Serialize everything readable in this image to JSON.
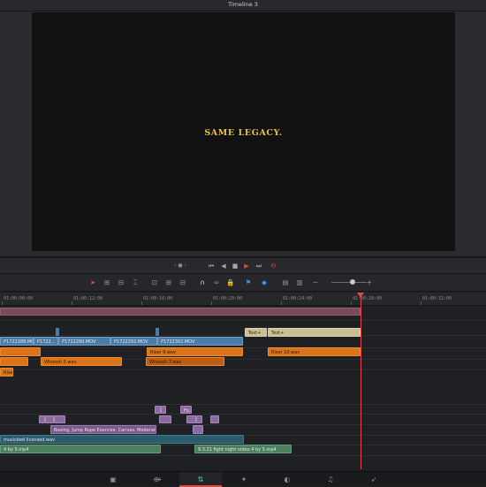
{
  "window": {
    "title": "Timeline 3"
  },
  "viewer": {
    "overlay_text": "SAME LEGACY."
  },
  "transport": {
    "jog_icon": "jog-wheel-icon",
    "buttons": [
      "first-frame-icon",
      "reverse-play-icon",
      "stop-icon",
      "play-icon",
      "last-frame-icon",
      "loop-icon"
    ],
    "accent": "#e04848"
  },
  "ruler": {
    "timecodes": [
      "01:00:08:00",
      "01:00:12:00",
      "01:00:16:00",
      "01:00:20:00",
      "01:00:24:00",
      "01:00:28:00",
      "01:00:32:00"
    ]
  },
  "clips": {
    "v2_title1": "Text+",
    "v2_title2": "Text+",
    "v1_a": "P1722288.MOV",
    "v1_b": "P1722...",
    "v1_c": "P1722290.MOV",
    "v1_d": "P1722292.MOV",
    "v1_e": "P1722302.MOV",
    "sfx_a": "Whoosh 5.wav",
    "sfx_b": "Riser 9.wav",
    "sfx_c": "Whoosh 7.wav",
    "sfx_d": "Riser 10.wav",
    "sfx_e": "Riser 9...",
    "fx_label": "Fo...",
    "boxing": "Boxing, Jump Rope Exercise, Canvas, Moderate, Wide...",
    "music": "musicbed licensed.wav",
    "green_a": "4 by 5.mp4",
    "green_b": "9.3.21 fight night video 4 by 5.mp4"
  },
  "colors": {
    "video": "#4b7ba6",
    "sfx": "#d9741b",
    "music": "#2c5b6b",
    "green": "#4b7f5e",
    "purple": "#7a5a8a",
    "overlay_yellow": "#e9c34a",
    "playhead": "#e04848"
  },
  "pages": [
    "media-icon",
    "cut-icon",
    "edit-icon",
    "fusion-icon",
    "color-icon",
    "fairlight-icon",
    "deliver-icon"
  ],
  "active_page": "edit-icon"
}
